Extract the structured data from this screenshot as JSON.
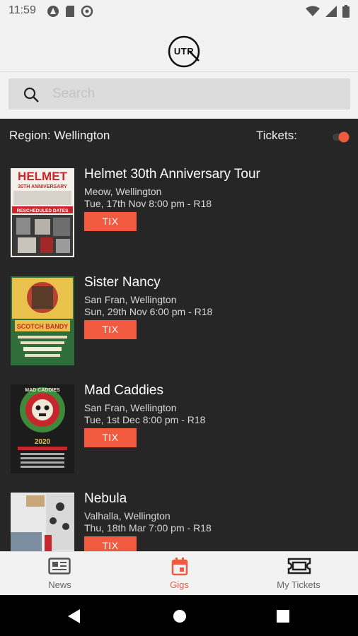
{
  "status_bar": {
    "time": "11:59"
  },
  "header": {
    "logo_text": "UTR"
  },
  "search": {
    "placeholder": "Search"
  },
  "filters": {
    "region_label": "Region: Wellington",
    "tickets_label": "Tickets:"
  },
  "gigs": [
    {
      "title": "Helmet 30th Anniversary Tour",
      "venue": "Meow, Wellington",
      "date": "Tue, 17th Nov 8:00 pm - R18",
      "button": "TIX",
      "poster_top": "HELMET",
      "poster_sub": "30TH ANNIVERSARY",
      "poster_banner": "RESCHEDULED DATES"
    },
    {
      "title": "Sister Nancy",
      "venue": "San Fran, Wellington",
      "date": "Sun, 29th Nov 6:00 pm - R18",
      "button": "TIX",
      "poster_banner": "SCOTCH BANDY"
    },
    {
      "title": "Mad Caddies",
      "venue": "San Fran, Wellington",
      "date": "Tue, 1st Dec 8:00 pm - R18",
      "button": "TIX",
      "poster_top": "MAD CADDIES",
      "poster_year": "2020"
    },
    {
      "title": "Nebula",
      "venue": "Valhalla, Wellington",
      "date": "Thu, 18th Mar 7:00 pm - R18",
      "button": "TIX"
    }
  ],
  "bottom_nav": [
    {
      "label": "News",
      "icon": "newspaper-icon"
    },
    {
      "label": "Gigs",
      "icon": "calendar-icon",
      "active": true
    },
    {
      "label": "My Tickets",
      "icon": "ticket-icon"
    }
  ],
  "colors": {
    "accent": "#f15a3f",
    "background": "#262626",
    "bar": "#f2f2f2"
  }
}
